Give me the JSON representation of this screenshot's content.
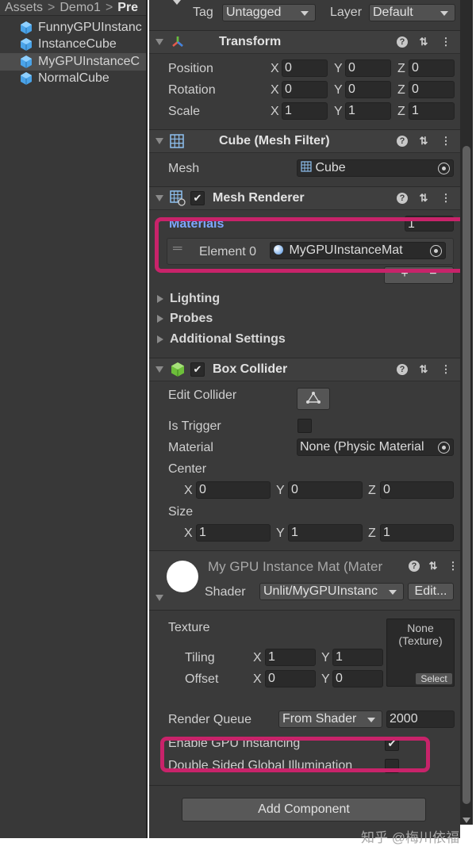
{
  "project": {
    "breadcrumb": [
      "Assets",
      "Demo1",
      "Pre"
    ],
    "assets": [
      {
        "name": "FunnyGPUInstanc",
        "selected": false
      },
      {
        "name": "InstanceCube",
        "selected": false
      },
      {
        "name": "MyGPUInstanceC",
        "selected": true
      },
      {
        "name": "NormalCube",
        "selected": false
      }
    ]
  },
  "inspector": {
    "tag_label": "Tag",
    "tag_value": "Untagged",
    "layer_label": "Layer",
    "layer_value": "Default",
    "transform": {
      "title": "Transform",
      "position_label": "Position",
      "rotation_label": "Rotation",
      "scale_label": "Scale",
      "axes": [
        "X",
        "Y",
        "Z"
      ],
      "position": [
        "0",
        "0",
        "0"
      ],
      "rotation": [
        "0",
        "0",
        "0"
      ],
      "scale": [
        "1",
        "1",
        "1"
      ]
    },
    "mesh_filter": {
      "title": "Cube (Mesh Filter)",
      "mesh_label": "Mesh",
      "mesh_value": "Cube"
    },
    "mesh_renderer": {
      "title": "Mesh Renderer",
      "enabled": true,
      "materials_label": "Materials",
      "materials_count": "1",
      "element_label": "Element 0",
      "element_value": "MyGPUInstanceMat",
      "add_label": "+",
      "remove_label": "−",
      "foldouts": [
        "Lighting",
        "Probes",
        "Additional Settings"
      ]
    },
    "box_collider": {
      "title": "Box Collider",
      "enabled": true,
      "edit_collider_label": "Edit Collider",
      "is_trigger_label": "Is Trigger",
      "is_trigger": false,
      "material_label": "Material",
      "material_value": "None (Physic Material",
      "center_label": "Center",
      "size_label": "Size",
      "center": [
        "0",
        "0",
        "0"
      ],
      "size": [
        "1",
        "1",
        "1"
      ]
    },
    "material": {
      "title": "My GPU Instance Mat (Mater",
      "shader_label": "Shader",
      "shader_value": "Unlit/MyGPUInstanc",
      "edit_label": "Edit...",
      "texture_label": "Texture",
      "texture_value": "None (Texture)",
      "texture_select_label": "Select",
      "tiling_label": "Tiling",
      "offset_label": "Offset",
      "tiling": [
        "1",
        "1"
      ],
      "offset": [
        "0",
        "0"
      ],
      "render_queue_label": "Render Queue",
      "render_queue_mode": "From Shader",
      "render_queue_value": "2000",
      "gpu_instancing_label": "Enable GPU Instancing",
      "gpu_instancing": true,
      "double_sided_gi_label": "Double Sided Global Illumination",
      "double_sided_gi": false
    },
    "add_component_label": "Add Component"
  },
  "watermark": "知乎 @梅川依福",
  "colors": {
    "highlight": "#c8236a",
    "accent": "#3a7bd5",
    "panel": "#3a3a3a"
  }
}
